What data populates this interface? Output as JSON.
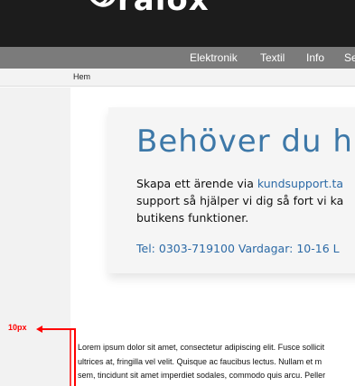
{
  "header": {
    "logo_text": "ralox"
  },
  "nav": {
    "items": [
      "Elektronik",
      "Textil",
      "Info",
      "Se"
    ]
  },
  "breadcrumb": {
    "home": "Hem"
  },
  "hero": {
    "title": "Behöver du h",
    "line1_prefix": "Skapa ett ärende via ",
    "line1_link": "kundsupport.ta",
    "line2": "support så hjälper vi dig så fort vi ka",
    "line3": "butikens funktioner.",
    "phone": "Tel: 0303-719100 Vardagar: 10-16 L"
  },
  "annotation": {
    "label": "10px",
    "color": "#ff0000"
  },
  "body_text": {
    "lines": [
      "Lorem ipsum dolor sit amet, consectetur adipiscing elit. Fusce sollicit",
      "ultrices at, fringilla vel velit. Quisque ac faucibus lectus. Nullam et m",
      "sem, tincidunt sit amet imperdiet sodales, commodo quis arcu. Peller"
    ]
  },
  "colors": {
    "topbar": "#1c1c1c",
    "navbar": "#7b7b7b",
    "accent": "#3d78a8"
  }
}
